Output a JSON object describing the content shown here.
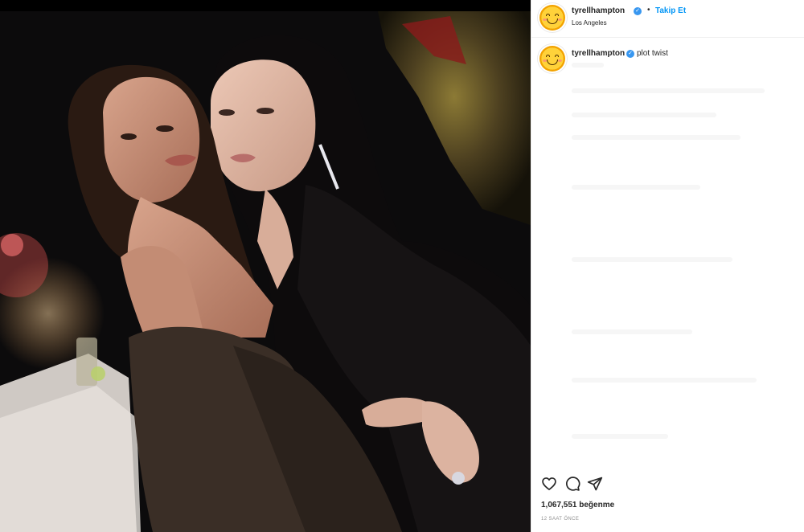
{
  "post": {
    "header": {
      "username": "tyrellhampton",
      "follow_label": "Takip Et",
      "separator": "•",
      "location": "Los Angeles",
      "verified_mark": "✓"
    },
    "caption": {
      "username": "tyrellhampton",
      "verified_mark": "✓",
      "text": "plot twist"
    },
    "likes_text": "1,067,551 beğenme",
    "timestamp": "12 SAAT ÖNCE"
  },
  "icons": {
    "avatar": "smiley-face-icon",
    "verified": "verified-badge-icon",
    "like": "heart-icon",
    "comment": "comment-bubble-icon",
    "share": "paper-plane-icon"
  },
  "colors": {
    "accent": "#0095f6",
    "verified": "#3897f0",
    "text": "#262626",
    "muted": "#8e8e8e",
    "photo_background": "#0b0a0b"
  }
}
